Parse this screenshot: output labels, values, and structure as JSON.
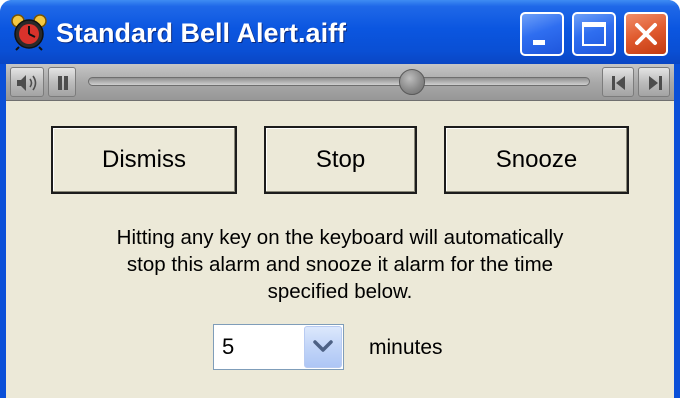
{
  "window": {
    "title": "Standard Bell Alert.aiff",
    "app_icon": "alarm-clock-icon",
    "controls": [
      "minimize-icon",
      "maximize-icon",
      "close-icon"
    ],
    "title_color": "#ffffff",
    "titlebar_color": "#0a4fd8",
    "close_color": "#e05a2e"
  },
  "player": {
    "volume_icon": "speaker-icon",
    "pause_icon": "pause-icon",
    "position": 0.645,
    "prev_icon": "previous-icon",
    "next_icon": "next-icon"
  },
  "buttons": {
    "dismiss": "Dismiss",
    "stop": "Stop",
    "snooze": "Snooze"
  },
  "message": {
    "line1": "Hitting any key on the keyboard will automatically",
    "line2": "stop this alarm and snooze it alarm for the time",
    "line3": "specified below."
  },
  "snooze": {
    "value": "5",
    "unit": "minutes",
    "dropdown_icon": "chevron-down-icon"
  }
}
